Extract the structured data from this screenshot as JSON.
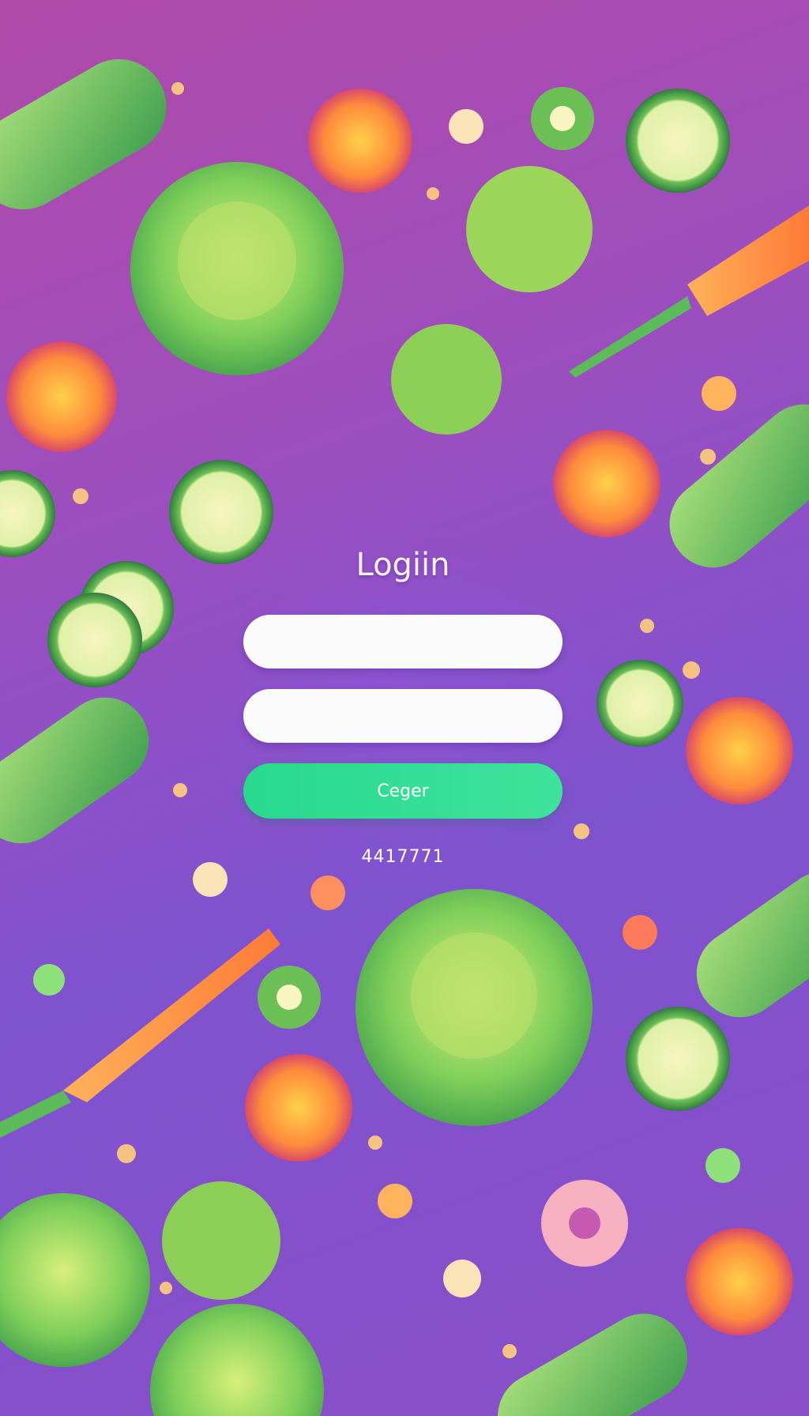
{
  "login": {
    "title": "Logiin",
    "username_value": "",
    "password_value": "",
    "button_label": "Ceger",
    "footer_text": "4417771"
  },
  "colors": {
    "background": "#9a4fc0",
    "button": "#32dd94",
    "field": "#fbfbfb",
    "text": "#ffffff"
  }
}
